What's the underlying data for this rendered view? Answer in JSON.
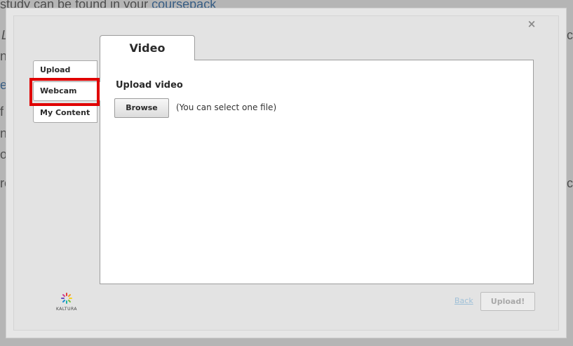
{
  "background": {
    "line1_prefix": "study can be found in your ",
    "line1_link": "coursepack",
    "fragments": [
      "L",
      "no",
      "e",
      "f",
      "nt",
      "os",
      "re"
    ],
    "right_fragments": [
      "c",
      "c"
    ]
  },
  "dialog": {
    "close_glyph": "×",
    "main_tab_label": "Video",
    "side_tabs": [
      "Upload",
      "Webcam",
      "My Content"
    ],
    "selected_tab": "Webcam",
    "heading": "Upload video",
    "browse_label": "Browse",
    "hint": "(You can select one file)",
    "logo_text": "KALTURA",
    "back_label": "Back",
    "upload_label": "Upload!"
  },
  "colors": {
    "highlight": "#e00000",
    "link": "#1a5fa6",
    "back_link": "#9fc0d8"
  }
}
